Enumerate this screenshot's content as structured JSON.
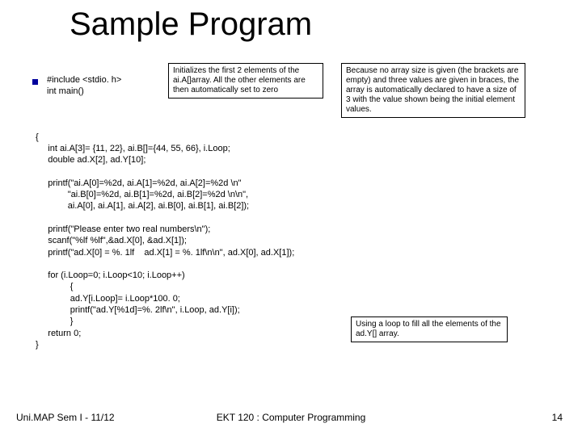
{
  "title": "Sample Program",
  "include": "#include <stdio. h>\nint main()",
  "code": "{\n     int ai.A[3]= {11, 22}, ai.B[]={44, 55, 66}, i.Loop;\n     double ad.X[2], ad.Y[10];\n\n     printf(\"ai.A[0]=%2d, ai.A[1]=%2d, ai.A[2]=%2d \\n\"\n             \"ai.B[0]=%2d, ai.B[1]=%2d, ai.B[2]=%2d \\n\\n\",\n             ai.A[0], ai.A[1], ai.A[2], ai.B[0], ai.B[1], ai.B[2]);\n\n     printf(\"Please enter two real numbers\\n\");\n     scanf(\"%lf %lf\",&ad.X[0], &ad.X[1]);\n     printf(\"ad.X[0] = %. 1lf    ad.X[1] = %. 1lf\\n\\n\", ad.X[0], ad.X[1]);\n\n     for (i.Loop=0; i.Loop<10; i.Loop++)\n              {\n              ad.Y[i.Loop]= i.Loop*100. 0;\n              printf(\"ad.Y[%1d]=%. 2lf\\n\", i.Loop, ad.Y[i]);\n              }\n     return 0;\n}",
  "callout1": "Initializes the first 2 elements of the ai.A[]array. All the other elements are then automatically set to zero",
  "callout2": "Because no array size is given (the brackets are empty) and three values are given in braces, the array is automatically declared to have a size of 3 with the value shown being the initial element values.",
  "callout3": "Using a loop to fill all the elements of the ad.Y[] array.",
  "footer_left": "Uni.MAP Sem I - 11/12",
  "footer_center": "EKT 120 : Computer Programming",
  "footer_right": "14"
}
